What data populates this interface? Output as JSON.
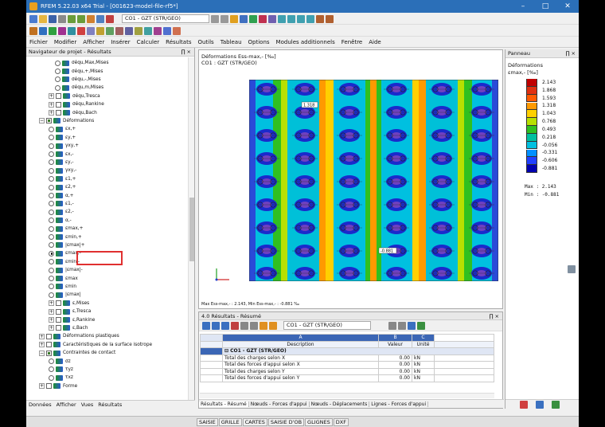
{
  "window": {
    "title": "RFEM 5.22.03 x64 Trial - [001623-model-file-rf5*]"
  },
  "toolbar": {
    "loadcase": "CO1 - GZT (STR/GEO)"
  },
  "menu": [
    "Fichier",
    "Modifier",
    "Afficher",
    "Insérer",
    "Calculer",
    "Résultats",
    "Outils",
    "Tableau",
    "Options",
    "Modules additionnels",
    "Fenêtre",
    "Aide"
  ],
  "navigator": {
    "title": "Navigateur de projet - Résultats",
    "items": [
      {
        "label": "σéqu,Max,Mises",
        "kind": "radio",
        "level": 3
      },
      {
        "label": "σéqu,+,Mises",
        "kind": "radio",
        "level": 3
      },
      {
        "label": "σéqu,-,Mises",
        "kind": "radio",
        "level": 3
      },
      {
        "label": "σéqu,m,Mises",
        "kind": "radio",
        "level": 3
      },
      {
        "label": "σéqu,Tresca",
        "kind": "check",
        "level": 2
      },
      {
        "label": "σéqu,Rankine",
        "kind": "check",
        "level": 2
      },
      {
        "label": "σéqu,Bach",
        "kind": "check",
        "level": 2
      },
      {
        "label": "Déformations",
        "kind": "checkon",
        "level": 1
      },
      {
        "label": "εx,+",
        "kind": "radio",
        "level": 2
      },
      {
        "label": "εy,+",
        "kind": "radio",
        "level": 2
      },
      {
        "label": "γxy,+",
        "kind": "radio",
        "level": 2
      },
      {
        "label": "εx,-",
        "kind": "radio",
        "level": 2
      },
      {
        "label": "εy,-",
        "kind": "radio",
        "level": 2
      },
      {
        "label": "γxy,-",
        "kind": "radio",
        "level": 2
      },
      {
        "label": "ε1,+",
        "kind": "radio",
        "level": 2
      },
      {
        "label": "ε2,+",
        "kind": "radio",
        "level": 2
      },
      {
        "label": "α,+",
        "kind": "radio",
        "level": 2
      },
      {
        "label": "ε1,-",
        "kind": "radio",
        "level": 2
      },
      {
        "label": "ε2,-",
        "kind": "radio",
        "level": 2
      },
      {
        "label": "α,-",
        "kind": "radio",
        "level": 2
      },
      {
        "label": "εmax,+",
        "kind": "radio",
        "level": 2
      },
      {
        "label": "εmin,+",
        "kind": "radio",
        "level": 2
      },
      {
        "label": "|εmax|+",
        "kind": "radio",
        "level": 2
      },
      {
        "label": "εmax,-",
        "kind": "radiosel",
        "level": 2
      },
      {
        "label": "εmin,-",
        "kind": "radio",
        "level": 2
      },
      {
        "label": "|εmax|-",
        "kind": "radio",
        "level": 2
      },
      {
        "label": "εmax",
        "kind": "radio",
        "level": 2
      },
      {
        "label": "εmin",
        "kind": "radio",
        "level": 2
      },
      {
        "label": "|εmax|",
        "kind": "radio",
        "level": 2
      },
      {
        "label": "ε,Mises",
        "kind": "check",
        "level": 2
      },
      {
        "label": "ε,Tresca",
        "kind": "check",
        "level": 2
      },
      {
        "label": "ε,Rankine",
        "kind": "check",
        "level": 2
      },
      {
        "label": "ε,Bach",
        "kind": "check",
        "level": 2
      },
      {
        "label": "Déformations plastiques",
        "kind": "check",
        "level": 1
      },
      {
        "label": "Caractéristiques de la surface isotrope",
        "kind": "check",
        "level": 1
      },
      {
        "label": "Contraintes de contact",
        "kind": "checkon",
        "level": 1
      },
      {
        "label": "σz",
        "kind": "radio",
        "level": 2
      },
      {
        "label": "τyz",
        "kind": "radio",
        "level": 2
      },
      {
        "label": "τxz",
        "kind": "radio",
        "level": 2
      },
      {
        "label": "Forme",
        "kind": "check",
        "level": 1
      }
    ],
    "tabs": [
      "Données",
      "Afficher",
      "Vues",
      "Résultats"
    ]
  },
  "view": {
    "line1": "Déformations Ess-max,- [‰]",
    "line2": "CO1 : GZT (STR/GEO)",
    "footer": "Max Ess-max,- : 2.143, Min Ess-max,- : -0.881 ‰",
    "tag1": "1.318",
    "tag2": "-0.881"
  },
  "results": {
    "title": "4.0 Résultats - Résumé",
    "loadcase": "CO1 - GZT (STR/GEO)",
    "col_letters": [
      "A",
      "B",
      "C"
    ],
    "col_names": [
      "Description",
      "Valeur",
      "Unité"
    ],
    "group": "CO1 - GZT (STR/GEO)",
    "rows": [
      {
        "d": "Total des charges selon X",
        "v": "0.00",
        "u": "kN"
      },
      {
        "d": "Total des forces d'appui selon X",
        "v": "0.00",
        "u": "kN"
      },
      {
        "d": "Total des charges selon Y",
        "v": "0.00",
        "u": "kN"
      },
      {
        "d": "Total des forces d'appui selon Y",
        "v": "0.00",
        "u": "kN"
      }
    ],
    "tabs": [
      "Résultats - Résumé",
      "Nœuds - Forces d'appui",
      "Nœuds - Déplacements",
      "Lignes - Forces d'appui"
    ]
  },
  "panel": {
    "title": "Panneau",
    "heading": "Déformations",
    "subheading": "εmax,- [‰]",
    "legend_values": [
      "2.143",
      "1.868",
      "1.593",
      "1.318",
      "1.043",
      "0.768",
      "0.493",
      "0.218",
      "-0.056",
      "-0.331",
      "-0.606",
      "-0.881"
    ],
    "legend_colors": [
      "#c00000",
      "#e03010",
      "#ff5a00",
      "#ff9a00",
      "#ffd000",
      "#b8e000",
      "#30c020",
      "#00c0a0",
      "#00c0e0",
      "#0090ff",
      "#2040ff",
      "#0000b0"
    ],
    "max_label": "Max :",
    "max_value": "2.143",
    "min_label": "Min :",
    "min_value": "-0.881"
  },
  "statusbar": [
    "SAISIE",
    "GRILLE",
    "CARTES",
    "SAISIE D'OB",
    "GLIGNES",
    "DXF"
  ]
}
